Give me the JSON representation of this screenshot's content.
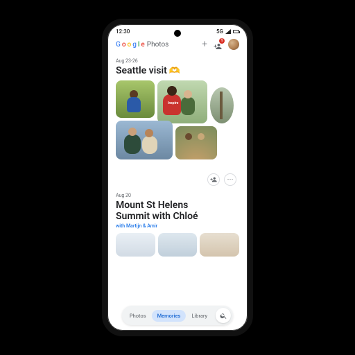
{
  "status": {
    "time": "12:30",
    "network": "5G"
  },
  "app": {
    "logo_letters": [
      "G",
      "o",
      "o",
      "g",
      "l",
      "e"
    ],
    "logo_suffix": "Photos",
    "notification_count": "1"
  },
  "memories": [
    {
      "date_range": "Aug 23-26",
      "title": "Seattle visit",
      "emoji": "🫶"
    },
    {
      "date_range": "Aug 20",
      "title_line1": "Mount St Helens",
      "title_line2": "Summit with Chloé",
      "subtitle": "with Martijn & Amir"
    }
  ],
  "nav": {
    "items": [
      "Photos",
      "Memories",
      "Library"
    ],
    "active_index": 1
  },
  "actions": {
    "add_people": "person-add-icon",
    "more": "⋯"
  }
}
